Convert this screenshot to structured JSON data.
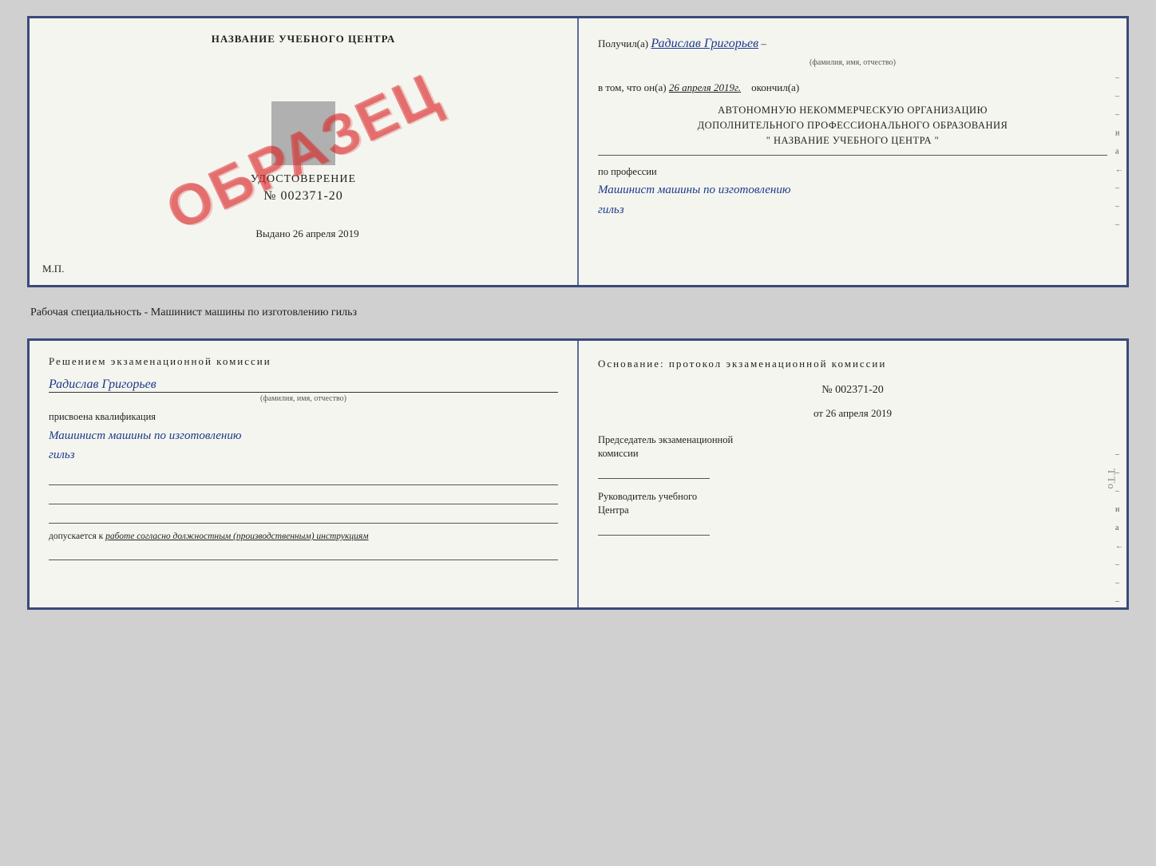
{
  "page": {
    "specialty_label": "Рабочая специальность - Машинист машины по изготовлению гильз"
  },
  "top_doc": {
    "left": {
      "school_name": "НАЗВАНИЕ УЧЕБНОГО ЦЕНТРА",
      "obrazets": "ОБРАЗЕЦ",
      "cert_label": "УДОСТОВЕРЕНИЕ",
      "cert_number": "№ 002371-20",
      "issued_label": "Выдано",
      "issued_date": "26 апреля 2019",
      "mp_label": "М.П."
    },
    "right": {
      "received_prefix": "Получил(а)",
      "received_name": "Радислав Григорьев",
      "fio_hint": "(фамилия, имя, отчество)",
      "dash": "–",
      "inthat_prefix": "в том, что он(а)",
      "inthat_date": "26 апреля 2019г.",
      "finished_label": "окончил(а)",
      "org_line1": "АВТОНОМНУЮ НЕКОММЕРЧЕСКУЮ ОРГАНИЗАЦИЮ",
      "org_line2": "ДОПОЛНИТЕЛЬНОГО ПРОФЕССИОНАЛЬНОГО ОБРАЗОВАНИЯ",
      "org_line3": "\"   НАЗВАНИЕ УЧЕБНОГО ЦЕНТРА   \"",
      "profession_label": "по профессии",
      "profession_handwritten1": "Машинист машины по изготовлению",
      "profession_handwritten2": "гильз",
      "side_markers": [
        "–",
        "–",
        "–",
        "и",
        "а",
        "←",
        "–",
        "–",
        "–"
      ]
    }
  },
  "bottom_doc": {
    "left": {
      "commission_title": "Решением  экзаменационной  комиссии",
      "person_name": "Радислав Григорьев",
      "fio_hint": "(фамилия, имя, отчество)",
      "assigned_label": "присвоена квалификация",
      "qual_hw1": "Машинист  машины  по изготовлению",
      "qual_hw2": "гильз",
      "допускается_prefix": "допускается к",
      "допускается_italic": "работе согласно должностным (производственным) инструкциям"
    },
    "right": {
      "osnov_title": "Основание:  протокол  экзаменационной  комиссии",
      "proto_number": "№  002371-20",
      "proto_date_prefix": "от",
      "proto_date": "26 апреля 2019",
      "chairman_title1": "Председатель экзаменационной",
      "chairman_title2": "комиссии",
      "head_title1": "Руководитель учебного",
      "head_title2": "Центра",
      "side_markers": [
        "–",
        "–",
        "–",
        "и",
        "а",
        "←",
        "–",
        "–",
        "–"
      ]
    }
  },
  "tto": "TTo"
}
